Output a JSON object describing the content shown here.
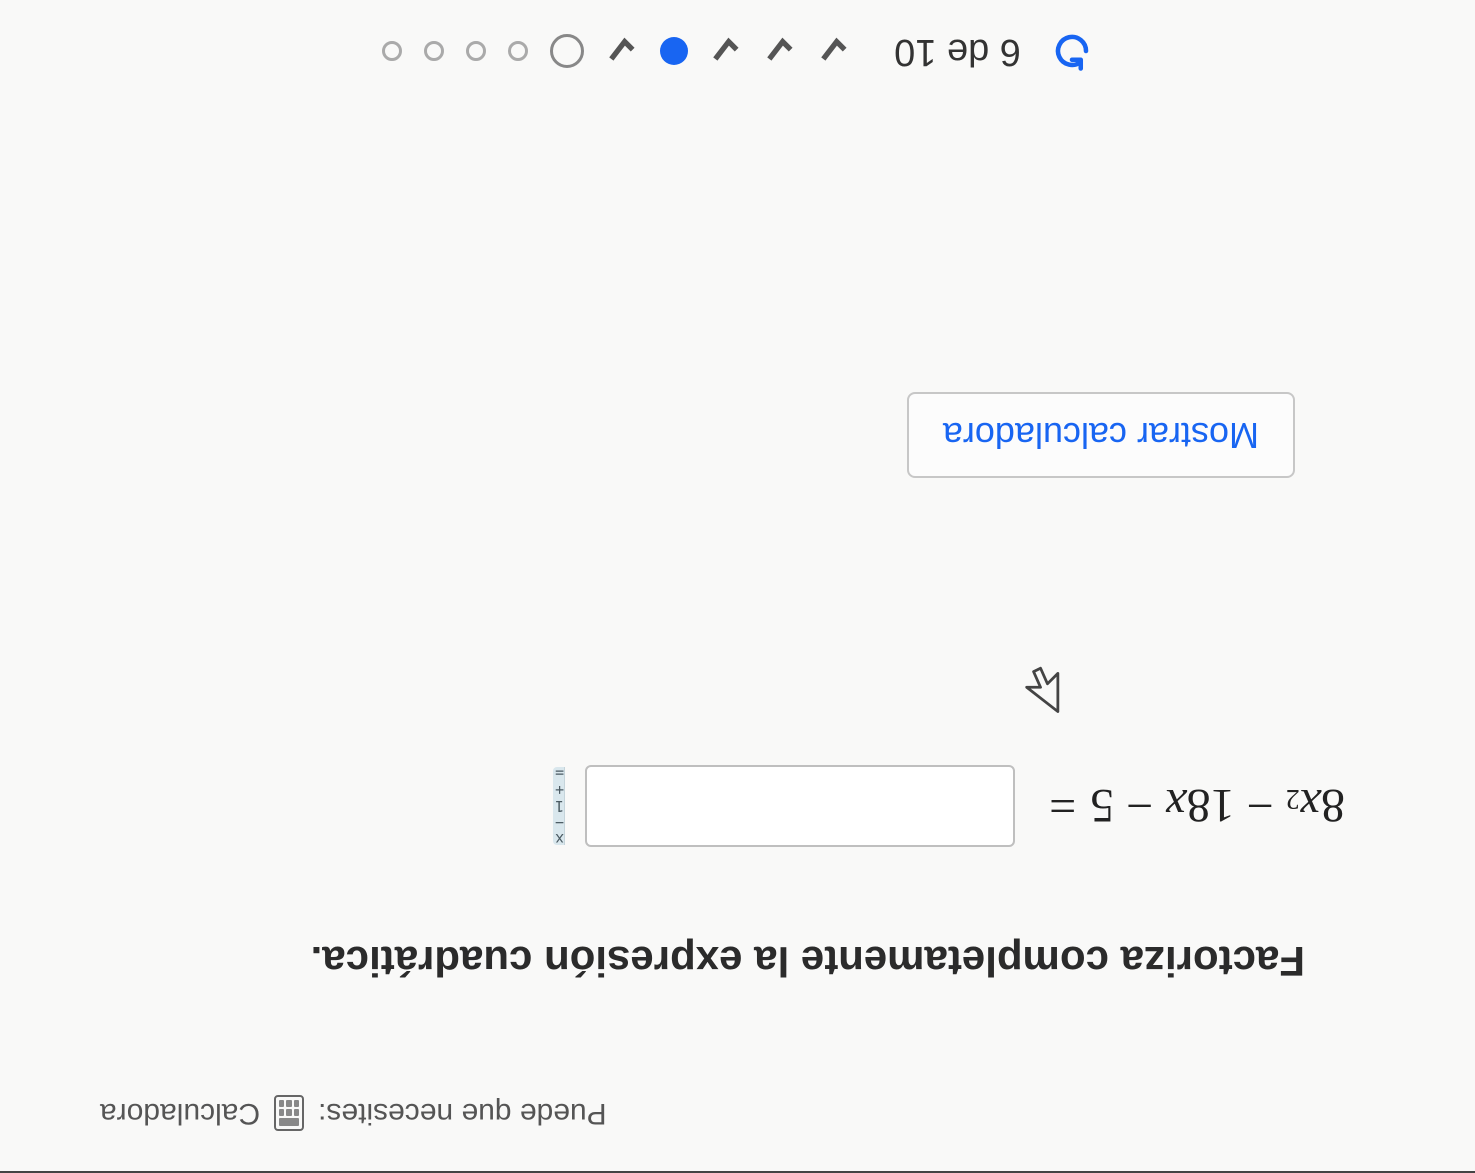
{
  "top": {
    "may_need_label": "Puede que necesites:",
    "calculator_label": "Calculadora"
  },
  "question": {
    "instruction": "Factoriza completamente la expresión cuadrática.",
    "expression": {
      "coeff1": "8",
      "var1": "x",
      "exp1": "2",
      "op1": "−",
      "coeff2": "18",
      "var2": "x",
      "op2": "−",
      "const": "5",
      "equals": "="
    },
    "answer_value": "",
    "keypad_line1": "x − 1",
    "keypad_line2": "+ ="
  },
  "buttons": {
    "show_calculator": "Mostrar calculadora"
  },
  "progress": {
    "text": "6 de 10",
    "items": [
      {
        "type": "check"
      },
      {
        "type": "check"
      },
      {
        "type": "check"
      },
      {
        "type": "filled"
      },
      {
        "type": "check"
      },
      {
        "type": "current"
      },
      {
        "type": "empty"
      },
      {
        "type": "empty"
      },
      {
        "type": "empty"
      },
      {
        "type": "empty"
      }
    ]
  }
}
